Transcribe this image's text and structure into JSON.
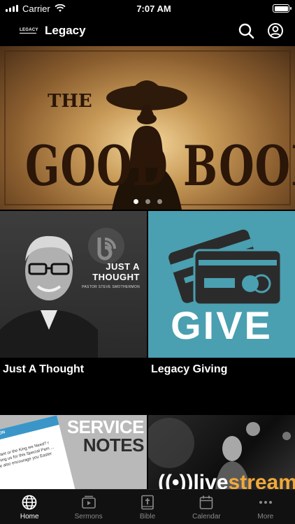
{
  "status_bar": {
    "carrier": "Carrier",
    "time": "7:07 AM"
  },
  "nav": {
    "logo_text": "LEGACY",
    "title": "Legacy",
    "icons": [
      "search-icon",
      "account-icon"
    ]
  },
  "hero": {
    "title_small": "THE",
    "title_left": "GOOD",
    "title_right": "BOOK",
    "pages": 3,
    "active_page": 1
  },
  "tiles": [
    {
      "id": "just-a-thought",
      "label": "Just A Thought",
      "image_title": [
        "JUST A",
        "THOUGHT"
      ],
      "image_subtitle": "PASTOR STEVE SMOTHERMON"
    },
    {
      "id": "legacy-giving",
      "label": "Legacy Giving",
      "image_text": "GIVE"
    },
    {
      "id": "service-notes",
      "image_title": [
        "SERVICE",
        "NOTES"
      ],
      "phone_header": "SERMON",
      "phone_text": "e Want or the King we Need? r joining us for this Special Pam ... We also encourage you Easter"
    },
    {
      "id": "livestream",
      "image_text_a": "((•))live",
      "image_text_b": "stream"
    }
  ],
  "tab_bar": {
    "items": [
      {
        "label": "Home",
        "icon": "globe-icon",
        "active": true
      },
      {
        "label": "Sermons",
        "icon": "play-icon",
        "active": false
      },
      {
        "label": "Bible",
        "icon": "bible-icon",
        "active": false
      },
      {
        "label": "Calendar",
        "icon": "calendar-icon",
        "active": false
      },
      {
        "label": "More",
        "icon": "more-icon",
        "active": false
      }
    ]
  },
  "colors": {
    "background": "#000000",
    "give_teal": "#4a9fb0",
    "tab_inactive": "#8a8a8a",
    "livestream_orange": "#f1a93b"
  }
}
